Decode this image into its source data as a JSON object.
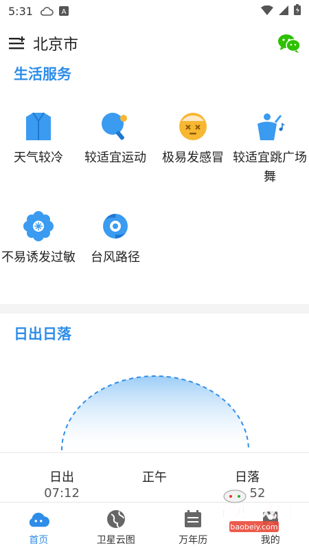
{
  "status_bar": {
    "time": "5:31"
  },
  "header": {
    "city": "北京市"
  },
  "life_services": {
    "title": "生活服务",
    "items": [
      {
        "label": "天气较冷",
        "icon": "clothes-icon"
      },
      {
        "label": "较适宜运动",
        "icon": "ping-pong-icon"
      },
      {
        "label": "极易发感冒",
        "icon": "sick-face-icon"
      },
      {
        "label": "较适宜跳广场舞",
        "icon": "dance-icon"
      },
      {
        "label": "不易诱发过敏",
        "icon": "allergy-flower-icon"
      },
      {
        "label": "台风路径",
        "icon": "typhoon-icon"
      }
    ]
  },
  "sun": {
    "title": "日出日落",
    "sunrise_label": "日出",
    "noon_label": "正午",
    "sunset_label": "日落",
    "sunrise_time": "07:12",
    "sunset_time": "52"
  },
  "nav": {
    "items": [
      {
        "label": "首页",
        "icon": "home-cloud-icon",
        "active": true
      },
      {
        "label": "卫星云图",
        "icon": "globe-icon",
        "active": false
      },
      {
        "label": "万年历",
        "icon": "calendar-icon",
        "active": false
      },
      {
        "label": "我的",
        "icon": "profile-icon",
        "active": false
      }
    ]
  },
  "watermark": {
    "text": "宝贝游戏网",
    "url_text": "baobeiy.com"
  },
  "colors": {
    "accent": "#2e8de8",
    "icon_blue": "#3a9bf0",
    "sick_face": "#f7b733"
  }
}
